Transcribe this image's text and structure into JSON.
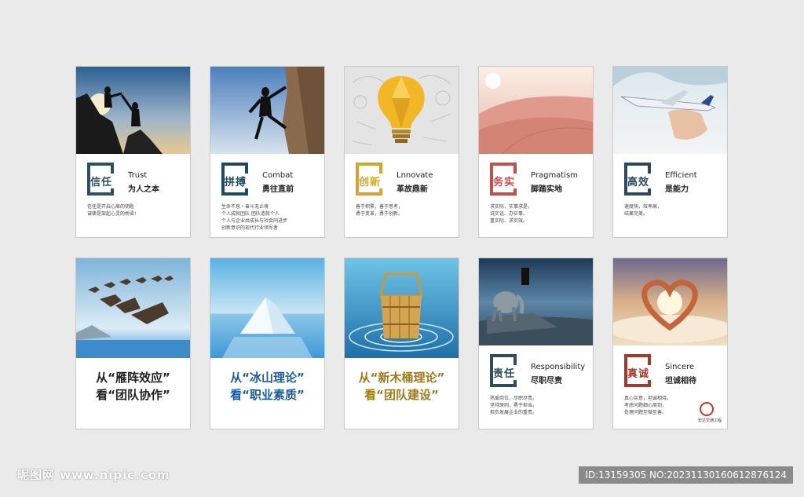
{
  "colors": {
    "background": "#eaeaeb",
    "trust": "#2e5066",
    "combat": "#1f4a64",
    "innovate": "#d6a431",
    "pragmatism": "#c0504d",
    "efficient": "#2c4860",
    "responsibility": "#2e4c5c",
    "sincere": "#a33a2e",
    "slogan_blue": "#1d5b94",
    "slogan_gold": "#9c7a1e",
    "slogan_dark": "#222222"
  },
  "cards": [
    {
      "word": "信任",
      "en": "Trust",
      "cn": "为人之本",
      "icon": "climbers-helping-hand-photo",
      "lines": [
        "信任是开启心扉的钥匙",
        "诚挚是架起心灵的桥梁!"
      ]
    },
    {
      "word": "拼搏",
      "en": "Combat",
      "cn": "勇往直前",
      "icon": "rock-climber-photo",
      "lines": [
        "生命不息・奋斗无止境",
        "个人成就团队 团队造就个人",
        "个人与企业共成长与社会同进步",
        "创新意识的现代行业领军者"
      ]
    },
    {
      "word": "创新",
      "en": "Lnnovate",
      "cn": "革故鼎新",
      "icon": "light-bulb-photo",
      "lines": [
        "善于积累，善于思考，",
        "勇于变革，勇于创新。"
      ]
    },
    {
      "word": "务实",
      "en": "Pragmatism",
      "cn": "脚踏实地",
      "icon": "desert-dunes-photo",
      "lines": [
        "求实际，实事求是，",
        "说实话、办实事、",
        "重实际、求实效。"
      ]
    },
    {
      "word": "高效",
      "en": "Efficient",
      "cn": "是能力",
      "icon": "hand-airplane-photo",
      "lines": [
        "速度快，效率高，",
        "结果完美。"
      ]
    }
  ],
  "slogans": [
    {
      "line1": "从“雁阵效应”",
      "line2": "看“团队协作”",
      "icon": "geese-flying-photo"
    },
    {
      "line1": "从“冰山理论”",
      "line2": "看“职业素质”",
      "icon": "iceberg-photo"
    },
    {
      "line1": "从“新木桶理论”",
      "line2": "看“团队建设”",
      "icon": "wooden-bucket-photo"
    }
  ],
  "responsibility": {
    "word": "责任",
    "en": "Responsibility",
    "cn": "尽职尽责",
    "icon": "stone-elephant-photo",
    "lines": [
      "热爱岗位，尽职尽责。",
      "坚持原则，勇于担当。",
      "担负发展企业的重责。"
    ]
  },
  "sincere": {
    "word": "真诚",
    "en": "Sincere",
    "cn": "坦诚相待",
    "icon": "heart-hands-photo",
    "lines": [
      "真心实意，坦诚相待。",
      "考虑问题细心周到，",
      "处理问题至微至善。"
    ],
    "logo_text": "宏达交通工程"
  },
  "watermark": {
    "left": "昵图网 www.nipic.com",
    "right": "ID:13159305 NO:20231130160612876124"
  }
}
